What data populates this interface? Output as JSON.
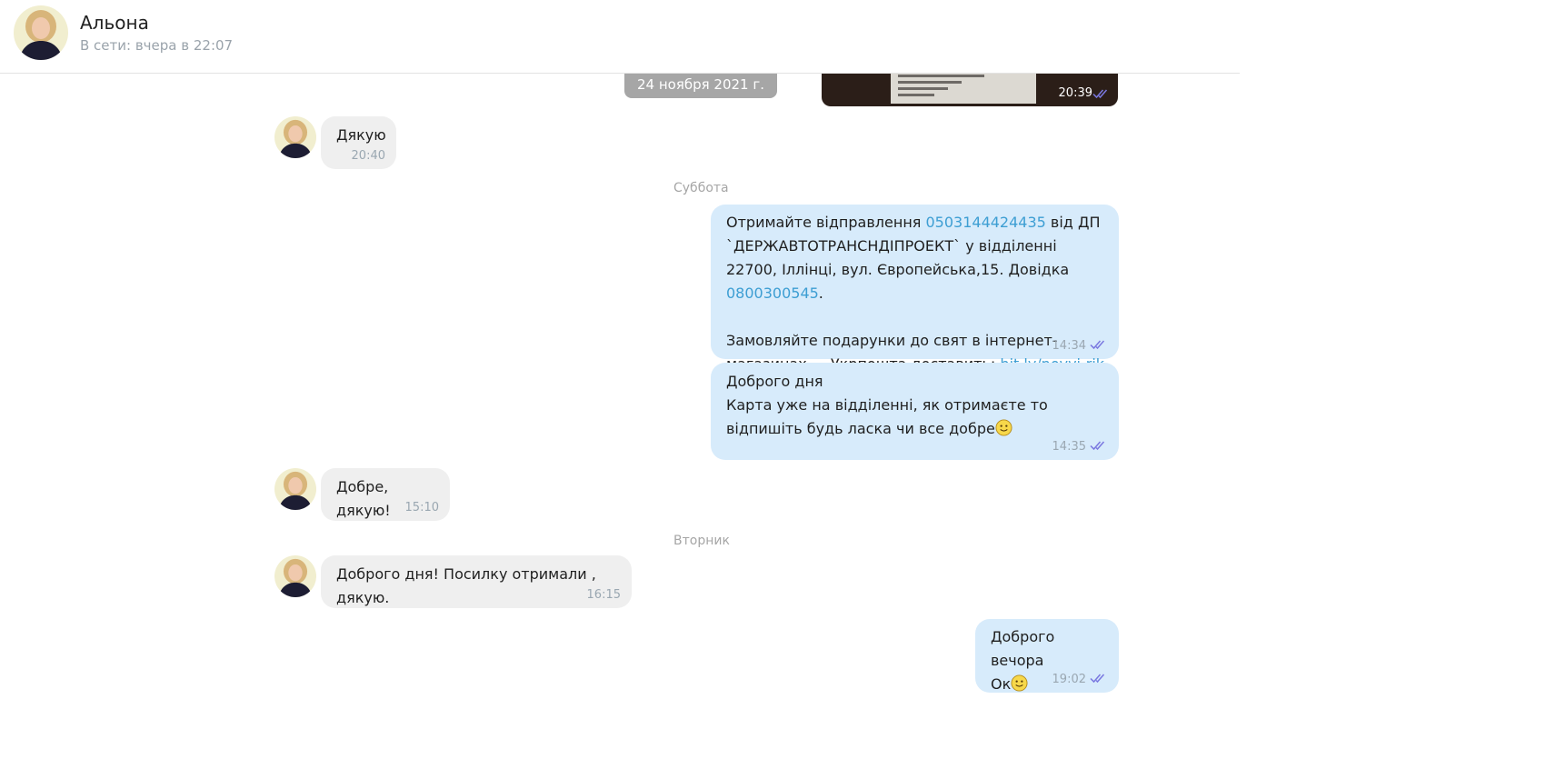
{
  "header": {
    "contact_name": "Альона",
    "status": "В сети: вчера в 22:07"
  },
  "photo_message": {
    "time": "20:39"
  },
  "date_pill": "24 ноября 2021 г.",
  "separators": {
    "saturday": "Суббота",
    "tuesday": "Вторник"
  },
  "messages": [
    {
      "direction": "in",
      "text": "Дякую",
      "time": "20:40"
    },
    {
      "direction": "out",
      "parts": {
        "p1": "Отримайте відправлення ",
        "phone1": "0503144424435",
        "p2": " від ДП `ДЕРЖАВТОТРАНСНДІПРОЕКТ` у відділенні 22700, Іллінці, вул. Європейська,15. Довідка ",
        "phone2": "0800300545",
        "p3": ".\n\nЗамовляйте подарунки до свят в інтернет-магазинах — Укрпошта доставить: ",
        "link": "bit.ly/novyi-rik"
      },
      "time": "14:34"
    },
    {
      "direction": "out",
      "text": "Доброго дня\nКарта уже на відділенні, як отримаєте то відпишіть будь ласка чи все добре",
      "emoji": "smiley-emoji",
      "time": "14:35"
    },
    {
      "direction": "in",
      "text": "Добре, дякую!",
      "time": "15:10"
    },
    {
      "direction": "in",
      "text": "Доброго дня! Посилку отримали , дякую.",
      "time": "16:15"
    },
    {
      "direction": "out",
      "text": "Доброго вечора\nОк",
      "emoji": "smiley-emoji",
      "time": "19:02"
    }
  ],
  "colors": {
    "incoming_bubble": "#efefef",
    "outgoing_bubble": "#d7ebfb",
    "link": "#3d9ed3",
    "read_ticks": "#7a78e0",
    "meta_text": "#9aa7b1"
  }
}
